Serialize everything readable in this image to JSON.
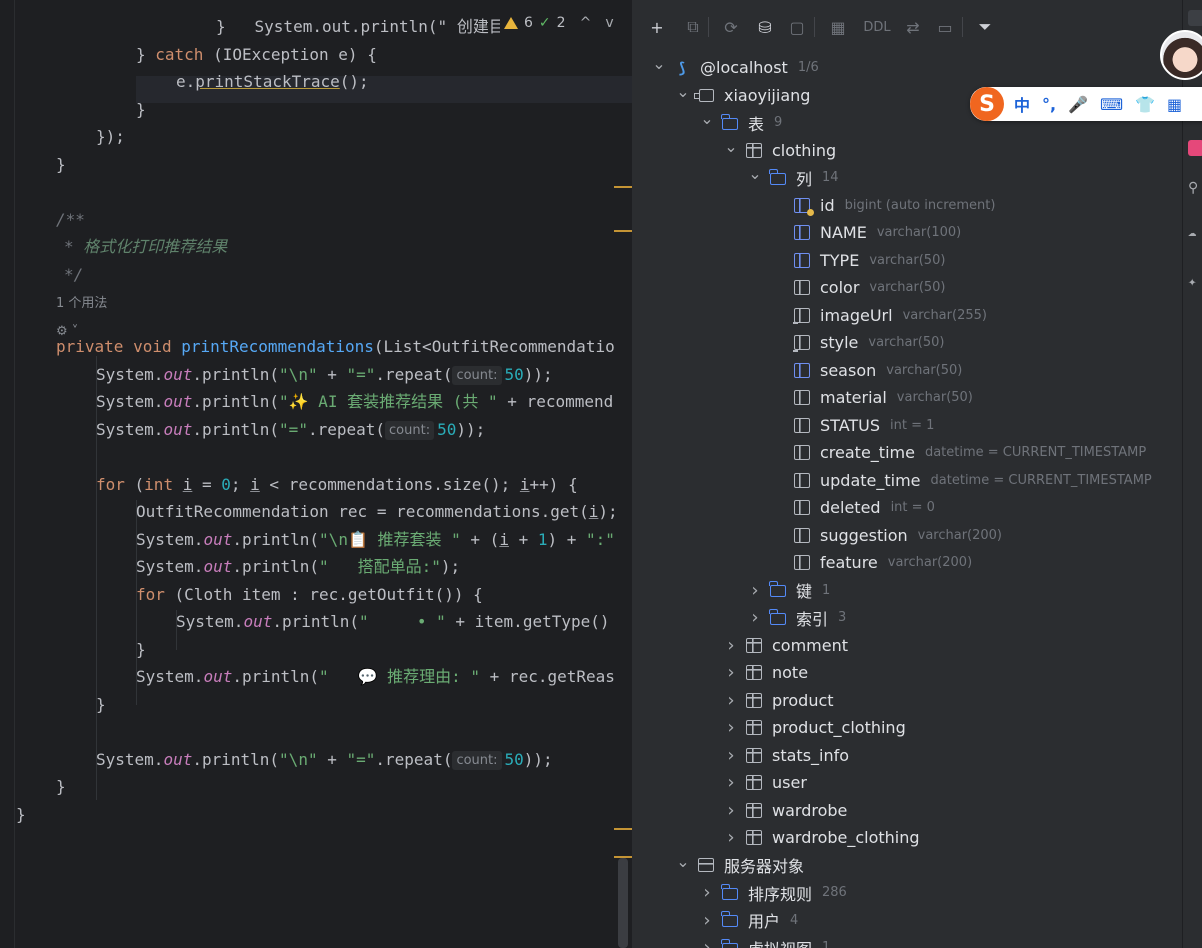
{
  "editor": {
    "inspection": {
      "warnings": "6",
      "weak_warnings": "2",
      "up": "^",
      "down": "v"
    },
    "top_fragment": "System.out.println(\" 创建目录失败",
    "lines": [
      {
        "id": "l0",
        "ind": 216,
        "segs": [
          [
            "",
            "}"
          ]
        ]
      },
      {
        "id": "l1",
        "ind": 136,
        "segs": [
          [
            "",
            "} "
          ],
          [
            "kw",
            "catch"
          ],
          [
            "",
            " (IOException e) {"
          ]
        ]
      },
      {
        "id": "l2",
        "ind": 176,
        "segs": [
          [
            "",
            "e."
          ],
          [
            "uline",
            "printStackTrace"
          ],
          [
            "",
            "();"
          ]
        ]
      },
      {
        "id": "l3",
        "ind": 136,
        "segs": [
          [
            "",
            "}"
          ]
        ]
      },
      {
        "id": "l4",
        "ind": 96,
        "segs": [
          [
            "",
            "});"
          ]
        ]
      },
      {
        "id": "l5",
        "ind": 56,
        "segs": [
          [
            "",
            "}"
          ]
        ]
      },
      {
        "id": "l6",
        "ind": 56,
        "segs": [
          [
            "cm",
            "/**"
          ]
        ]
      },
      {
        "id": "l7",
        "ind": 64,
        "segs": [
          [
            "cm",
            "* "
          ],
          [
            "cmt",
            "格式化打印推荐结果"
          ]
        ]
      },
      {
        "id": "l8",
        "ind": 64,
        "segs": [
          [
            "cm",
            "*/"
          ]
        ]
      },
      {
        "id": "l9",
        "ind": 56,
        "segs": [
          [
            "usage",
            "1 个用法"
          ]
        ]
      },
      {
        "id": "l10",
        "ind": 56,
        "segs": [
          [
            "usage",
            "⚙ ˅"
          ]
        ]
      },
      {
        "id": "l11",
        "ind": 56,
        "segs": [
          [
            "kw",
            "private void "
          ],
          [
            "fn",
            "printRecommendations"
          ],
          [
            "",
            "(List<OutfitRecommendatio"
          ]
        ]
      },
      {
        "id": "l12",
        "ind": 96,
        "segs": [
          [
            "",
            "System."
          ],
          [
            "it",
            "out"
          ],
          [
            "",
            ".println("
          ],
          [
            "st",
            "\"\\n\""
          ],
          [
            "",
            " + "
          ],
          [
            "st",
            "\"=\""
          ],
          [
            "",
            ".repeat("
          ],
          [
            "hint",
            "count:"
          ],
          [
            "nm",
            "50"
          ],
          [
            "",
            "));"
          ]
        ]
      },
      {
        "id": "l13",
        "ind": 96,
        "segs": [
          [
            "",
            "System."
          ],
          [
            "it",
            "out"
          ],
          [
            "",
            ".println("
          ],
          [
            "st",
            "\"✨ AI 套装推荐结果 (共 \""
          ],
          [
            "",
            " + recommend"
          ]
        ]
      },
      {
        "id": "l14",
        "ind": 96,
        "segs": [
          [
            "",
            "System."
          ],
          [
            "it",
            "out"
          ],
          [
            "",
            ".println("
          ],
          [
            "st",
            "\"=\""
          ],
          [
            "",
            ".repeat("
          ],
          [
            "hint",
            "count:"
          ],
          [
            "nm",
            "50"
          ],
          [
            "",
            "));"
          ]
        ]
      },
      {
        "id": "l15",
        "ind": 96,
        "segs": []
      },
      {
        "id": "l16",
        "ind": 96,
        "segs": [
          [
            "kw",
            "for"
          ],
          [
            "",
            " ("
          ],
          [
            "kw",
            "int "
          ],
          [
            "ul2",
            "i"
          ],
          [
            "",
            " = "
          ],
          [
            "nm",
            "0"
          ],
          [
            "",
            "; "
          ],
          [
            "ul2",
            "i"
          ],
          [
            "",
            " < recommendations.size(); "
          ],
          [
            "ul2",
            "i"
          ],
          [
            "",
            "++) {"
          ]
        ]
      },
      {
        "id": "l17",
        "ind": 136,
        "segs": [
          [
            "",
            "OutfitRecommendation rec = recommendations.get("
          ],
          [
            "ul2",
            "i"
          ],
          [
            "",
            ");"
          ]
        ]
      },
      {
        "id": "l18",
        "ind": 136,
        "segs": [
          [
            "",
            "System."
          ],
          [
            "it",
            "out"
          ],
          [
            "",
            ".println("
          ],
          [
            "st",
            "\"\\n📋 推荐套装 \""
          ],
          [
            "",
            " + ("
          ],
          [
            "ul2",
            "i"
          ],
          [
            "",
            " + "
          ],
          [
            "nm",
            "1"
          ],
          [
            "",
            ") + "
          ],
          [
            "st",
            "\":\""
          ]
        ]
      },
      {
        "id": "l19",
        "ind": 136,
        "segs": [
          [
            "",
            "System."
          ],
          [
            "it",
            "out"
          ],
          [
            "",
            ".println("
          ],
          [
            "st",
            "\"   搭配单品:\""
          ],
          [
            "",
            ");"
          ]
        ]
      },
      {
        "id": "l20",
        "ind": 136,
        "segs": [
          [
            "kw",
            "for"
          ],
          [
            "",
            " (Cloth item : rec.getOutfit()) {"
          ]
        ]
      },
      {
        "id": "l21",
        "ind": 176,
        "segs": [
          [
            "",
            "System."
          ],
          [
            "it",
            "out"
          ],
          [
            "",
            ".println("
          ],
          [
            "st",
            "\"     • \""
          ],
          [
            "",
            " + item.getType()"
          ]
        ]
      },
      {
        "id": "l22",
        "ind": 136,
        "segs": [
          [
            "",
            "}"
          ]
        ]
      },
      {
        "id": "l23",
        "ind": 136,
        "segs": [
          [
            "",
            "System."
          ],
          [
            "it",
            "out"
          ],
          [
            "",
            ".println("
          ],
          [
            "st",
            "\"   💬 推荐理由: \""
          ],
          [
            "",
            " + rec.getReas"
          ]
        ]
      },
      {
        "id": "l24",
        "ind": 96,
        "segs": [
          [
            "",
            "}"
          ]
        ]
      },
      {
        "id": "l25",
        "ind": 96,
        "segs": []
      },
      {
        "id": "l26",
        "ind": 96,
        "segs": [
          [
            "",
            "System."
          ],
          [
            "it",
            "out"
          ],
          [
            "",
            ".println("
          ],
          [
            "st",
            "\"\\n\""
          ],
          [
            "",
            " + "
          ],
          [
            "st",
            "\"=\""
          ],
          [
            "",
            ".repeat("
          ],
          [
            "hint",
            "count:"
          ],
          [
            "nm",
            "50"
          ],
          [
            "",
            "));"
          ]
        ]
      },
      {
        "id": "l27",
        "ind": 56,
        "segs": [
          [
            "",
            "}"
          ]
        ]
      },
      {
        "id": "l28",
        "ind": 16,
        "segs": [
          [
            "",
            "}"
          ]
        ]
      }
    ]
  },
  "database": {
    "toolbar": [
      {
        "name": "new-icon",
        "glyph": "+",
        "on": true
      },
      {
        "name": "copy-icon",
        "glyph": "⧉",
        "on": false
      },
      {
        "name": "refresh-icon",
        "glyph": "⟳",
        "on": false
      },
      {
        "name": "data-source-properties-icon",
        "glyph": "⛁",
        "on": true
      },
      {
        "name": "stop-icon",
        "glyph": "▢",
        "on": false
      },
      {
        "name": "table-view-icon",
        "glyph": "▦",
        "on": false
      },
      {
        "name": "ddl-button",
        "glyph": "DDL",
        "on": false
      },
      {
        "name": "jump-icon",
        "glyph": "⇄",
        "on": false
      },
      {
        "name": "console-icon",
        "glyph": "▭",
        "on": false
      },
      {
        "name": "filter-icon",
        "glyph": "⏷",
        "on": true
      }
    ],
    "tree": [
      {
        "id": "t0",
        "lvl": 0,
        "exp": "v",
        "icon": "mysql",
        "name": "@localhost",
        "meta": "1/6"
      },
      {
        "id": "t1",
        "lvl": 1,
        "exp": "v",
        "icon": "schema",
        "name": "xiaoyijiang",
        "meta": ""
      },
      {
        "id": "t2",
        "lvl": 2,
        "exp": "v",
        "icon": "folder",
        "name": "表",
        "meta": "9"
      },
      {
        "id": "t3",
        "lvl": 3,
        "exp": "v",
        "icon": "table",
        "name": "clothing",
        "meta": ""
      },
      {
        "id": "t4",
        "lvl": 4,
        "exp": "v",
        "icon": "folder",
        "name": "列",
        "meta": "14"
      },
      {
        "id": "t5",
        "lvl": 5,
        "exp": "",
        "icon": "col-key",
        "name": "id",
        "meta": "bigint (auto increment)"
      },
      {
        "id": "t6",
        "lvl": 5,
        "exp": "",
        "icon": "col-idx",
        "name": "NAME",
        "meta": "varchar(100)"
      },
      {
        "id": "t7",
        "lvl": 5,
        "exp": "",
        "icon": "col-idx",
        "name": "TYPE",
        "meta": "varchar(50)"
      },
      {
        "id": "t8",
        "lvl": 5,
        "exp": "",
        "icon": "col",
        "name": "color",
        "meta": "varchar(50)"
      },
      {
        "id": "t9",
        "lvl": 5,
        "exp": "",
        "icon": "col-nn",
        "name": "imageUrl",
        "meta": "varchar(255)"
      },
      {
        "id": "t10",
        "lvl": 5,
        "exp": "",
        "icon": "col-nn",
        "name": "style",
        "meta": "varchar(50)"
      },
      {
        "id": "t11",
        "lvl": 5,
        "exp": "",
        "icon": "col-idx",
        "name": "season",
        "meta": "varchar(50)"
      },
      {
        "id": "t12",
        "lvl": 5,
        "exp": "",
        "icon": "col",
        "name": "material",
        "meta": "varchar(50)"
      },
      {
        "id": "t13",
        "lvl": 5,
        "exp": "",
        "icon": "col",
        "name": "STATUS",
        "meta": "int = 1"
      },
      {
        "id": "t14",
        "lvl": 5,
        "exp": "",
        "icon": "col",
        "name": "create_time",
        "meta": "datetime = CURRENT_TIMESTAMP"
      },
      {
        "id": "t15",
        "lvl": 5,
        "exp": "",
        "icon": "col",
        "name": "update_time",
        "meta": "datetime = CURRENT_TIMESTAMP"
      },
      {
        "id": "t16",
        "lvl": 5,
        "exp": "",
        "icon": "col",
        "name": "deleted",
        "meta": "int = 0"
      },
      {
        "id": "t17",
        "lvl": 5,
        "exp": "",
        "icon": "col",
        "name": "suggestion",
        "meta": "varchar(200)"
      },
      {
        "id": "t18",
        "lvl": 5,
        "exp": "",
        "icon": "col",
        "name": "feature",
        "meta": "varchar(200)"
      },
      {
        "id": "t19",
        "lvl": 4,
        "exp": ">",
        "icon": "folder",
        "name": "键",
        "meta": "1"
      },
      {
        "id": "t20",
        "lvl": 4,
        "exp": ">",
        "icon": "folder",
        "name": "索引",
        "meta": "3"
      },
      {
        "id": "t21",
        "lvl": 3,
        "exp": ">",
        "icon": "table",
        "name": "comment",
        "meta": ""
      },
      {
        "id": "t22",
        "lvl": 3,
        "exp": ">",
        "icon": "table",
        "name": "note",
        "meta": ""
      },
      {
        "id": "t23",
        "lvl": 3,
        "exp": ">",
        "icon": "table",
        "name": "product",
        "meta": ""
      },
      {
        "id": "t24",
        "lvl": 3,
        "exp": ">",
        "icon": "table",
        "name": "product_clothing",
        "meta": ""
      },
      {
        "id": "t25",
        "lvl": 3,
        "exp": ">",
        "icon": "table",
        "name": "stats_info",
        "meta": ""
      },
      {
        "id": "t26",
        "lvl": 3,
        "exp": ">",
        "icon": "table",
        "name": "user",
        "meta": ""
      },
      {
        "id": "t27",
        "lvl": 3,
        "exp": ">",
        "icon": "table",
        "name": "wardrobe",
        "meta": ""
      },
      {
        "id": "t28",
        "lvl": 3,
        "exp": ">",
        "icon": "table",
        "name": "wardrobe_clothing",
        "meta": ""
      },
      {
        "id": "t29",
        "lvl": 1,
        "exp": "v",
        "icon": "server",
        "name": "服务器对象",
        "meta": ""
      },
      {
        "id": "t30",
        "lvl": 2,
        "exp": ">",
        "icon": "folder",
        "name": "排序规则",
        "meta": "286"
      },
      {
        "id": "t31",
        "lvl": 2,
        "exp": ">",
        "icon": "folder",
        "name": "用户",
        "meta": "4"
      },
      {
        "id": "t32",
        "lvl": 2,
        "exp": ">",
        "icon": "folder",
        "name": "虚拟视图",
        "meta": "1"
      }
    ]
  },
  "ime_toolbar": {
    "logo": "S",
    "items": [
      {
        "name": "chinese-mode-icon",
        "glyph": "中"
      },
      {
        "name": "punctuation-icon",
        "glyph": "°,"
      },
      {
        "name": "microphone-icon",
        "glyph": "🎤"
      },
      {
        "name": "keyboard-icon",
        "glyph": "⌨"
      },
      {
        "name": "skin-icon",
        "glyph": "👕"
      },
      {
        "name": "toolbox-icon",
        "glyph": "▦"
      }
    ]
  },
  "colors": {
    "accent": "#548af7",
    "warning": "#e7b43c",
    "ok": "#5fb865",
    "ime": "#f0661f"
  }
}
